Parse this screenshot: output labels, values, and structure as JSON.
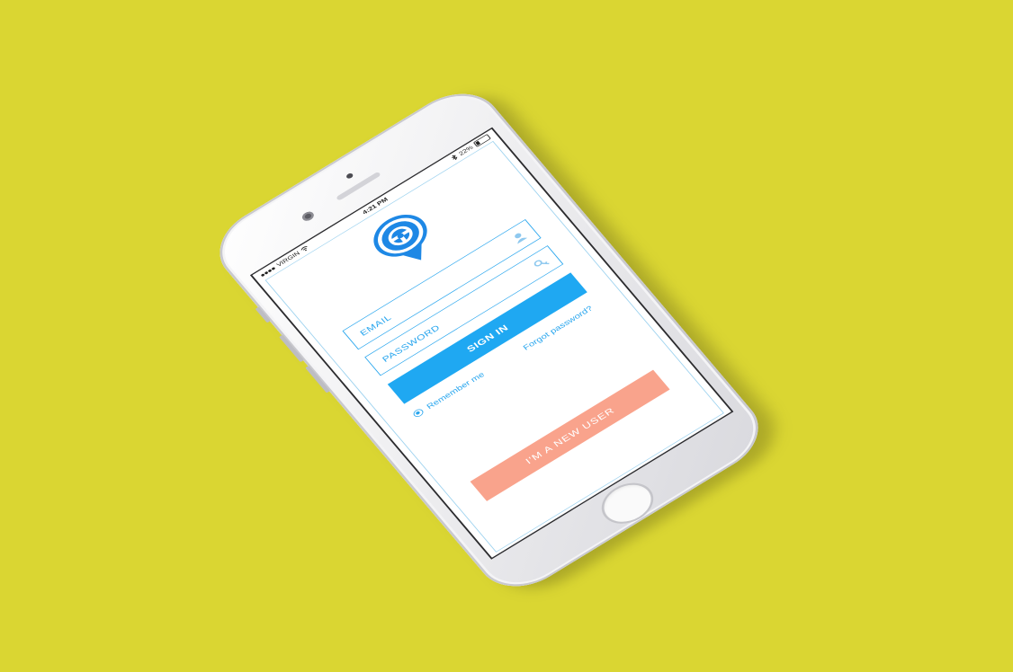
{
  "status_bar": {
    "carrier": "VIRGIN",
    "time": "4:21 PM",
    "battery": "22%"
  },
  "login": {
    "email_label": "EMAIL",
    "password_label": "PASSWORD",
    "sign_in_label": "SIGN IN",
    "remember_label": "Remember me",
    "forgot_label": "Forgot password?",
    "new_user_label": "I'M A NEW USER"
  },
  "colors": {
    "background": "#dad632",
    "accent_blue": "#1fa8f2",
    "new_user_salmon": "#f9a38c"
  },
  "icons": {
    "logo": "steering-wheel-pin-icon",
    "email": "user-icon",
    "password": "key-icon"
  }
}
